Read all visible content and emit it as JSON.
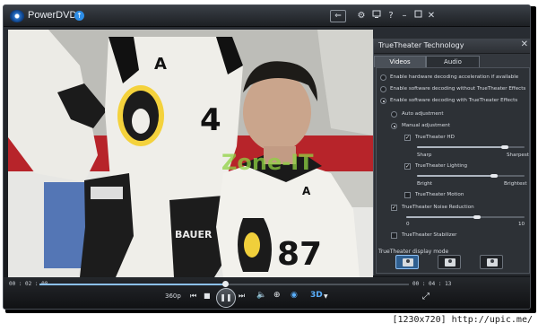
{
  "app": {
    "title": "PowerDVD"
  },
  "titlebar": {
    "icons": [
      "back-icon",
      "gear-icon",
      "display-icon",
      "help-icon",
      "minimize-icon",
      "restore-icon",
      "close-icon"
    ],
    "help_label": "?"
  },
  "video": {
    "watermark": "Zone-IT",
    "jersey_number_left": "4",
    "jersey_number_front": "87",
    "helmet_text": "BAUER"
  },
  "panel": {
    "title": "TrueTheater Technology",
    "tabs": [
      {
        "label": "Videos",
        "active": true
      },
      {
        "label": "Audio",
        "active": false
      }
    ],
    "decoding_options": [
      {
        "label": "Enable hardware decoding acceleration if available",
        "selected": false
      },
      {
        "label": "Enable software decoding without TrueTheater Effects",
        "selected": false
      },
      {
        "label": "Enable software decoding with TrueTheater Effects",
        "selected": true
      }
    ],
    "adjust_options": [
      {
        "label": "Auto adjustment",
        "selected": false
      },
      {
        "label": "Manual adjustment",
        "selected": true
      }
    ],
    "hd": {
      "label": "TrueTheater HD",
      "checked": true,
      "min_label": "Sharp",
      "max_label": "Sharpest",
      "level": 0.82
    },
    "lighting": {
      "label": "TrueTheater Lighting",
      "checked": true,
      "min_label": "Bright",
      "max_label": "Brightest",
      "level": 0.72
    },
    "motion": {
      "label": "TrueTheater Motion",
      "checked": false
    },
    "noise": {
      "label": "TrueTheater Noise Reduction",
      "checked": true,
      "min_label": "0",
      "max_label": "10",
      "level": 0.6
    },
    "stabilizer": {
      "label": "TrueTheater Stabilizer",
      "checked": false
    },
    "display_mode": {
      "label": "TrueTheater display mode",
      "modes": [
        "full-mode",
        "split-mode",
        "compare-mode"
      ],
      "active": 0
    }
  },
  "controls": {
    "time_elapsed": "00 : 02 : 08",
    "time_total": "00 : 04 : 13",
    "progress": 0.505,
    "resolution": "360p",
    "threed_label": "3D",
    "accent": "#8cc1f2"
  },
  "footer": {
    "caption": "[1230x720] http://upic.me/"
  }
}
